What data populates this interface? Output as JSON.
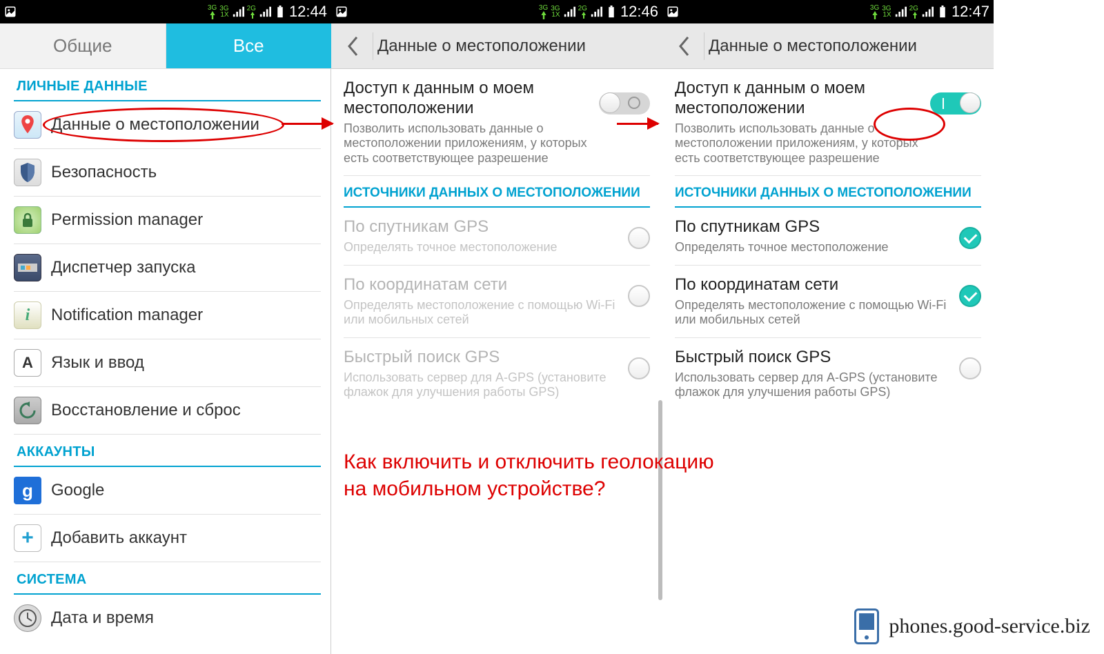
{
  "statusbar": {
    "clock1": "12:44",
    "clock2": "12:46",
    "clock3": "12:47",
    "net1": "3G",
    "net2": "3G",
    "net2b": "1X",
    "net3": "2G"
  },
  "screen1": {
    "tabs": {
      "general": "Общие",
      "all": "Все"
    },
    "sections": {
      "personal": "ЛИЧНЫЕ ДАННЫЕ",
      "accounts": "АККАУНТЫ",
      "system": "СИСТЕМА"
    },
    "items": {
      "location": "Данные о местоположении",
      "security": "Безопасность",
      "permission": "Permission manager",
      "dispatcher": "Диспетчер запуска",
      "notification": "Notification manager",
      "language": "Язык и ввод",
      "backup": "Восстановление и сброс",
      "google": "Google",
      "addacct": "Добавить аккаунт",
      "datetime": "Дата и время"
    }
  },
  "screen2": {
    "header": "Данные о местоположении",
    "access_title": "Доступ к данным о моем местоположении",
    "access_desc": "Позволить использовать данные о местоположении приложениям, у которых есть соответствующее разрешение",
    "sources_header": "ИСТОЧНИКИ ДАННЫХ О МЕСТОПОЛОЖЕНИИ",
    "gps_title": "По спутникам GPS",
    "gps_desc": "Определять точное местоположение",
    "net_title": "По координатам сети",
    "net_desc": "Определять местоположение с помощью Wi-Fi или мобильных сетей",
    "agps_title": "Быстрый поиск GPS",
    "agps_desc": "Использовать сервер для A-GPS (установите флажок для улучшения работы GPS)"
  },
  "annotations": {
    "caption_line1": "Как включить и отключить геолокацию",
    "caption_line2": "на мобильном устройстве?",
    "watermark": "phones.good-service.biz"
  }
}
